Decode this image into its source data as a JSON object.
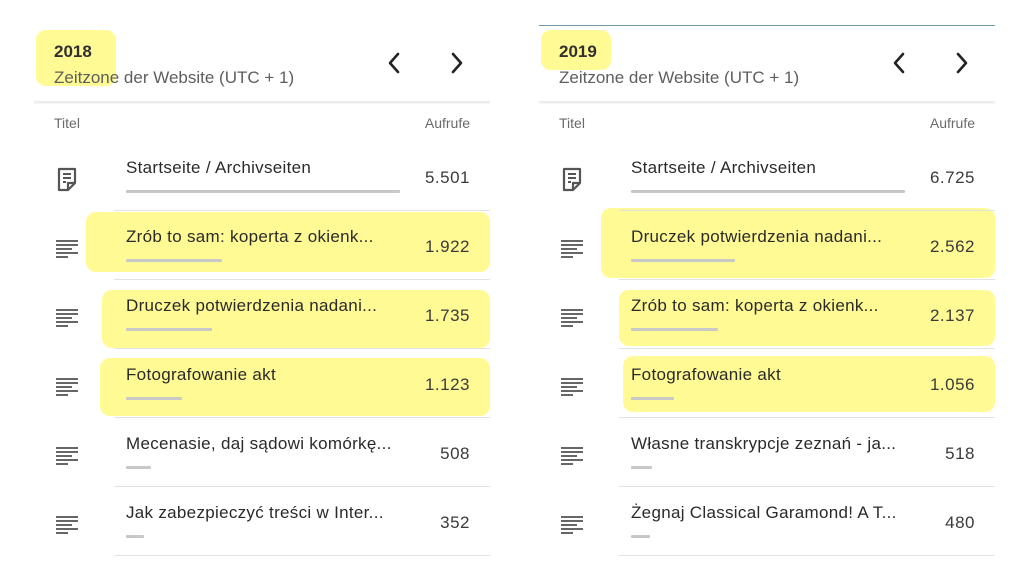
{
  "columns": {
    "title": "Titel",
    "views": "Aufrufe"
  },
  "timezone": "Zeitzone der Website (UTC + 1)",
  "panels": [
    {
      "year": "2018",
      "rows": [
        {
          "icon": "page-icon",
          "title": "Startseite / Archivseiten",
          "views": "5.501",
          "share": 1.0
        },
        {
          "icon": "post-icon",
          "title": "Zrób to sam: koperta z okienk...",
          "views": "1.922",
          "share": 0.35
        },
        {
          "icon": "post-icon",
          "title": "Druczek potwierdzenia nadani...",
          "views": "1.735",
          "share": 0.315
        },
        {
          "icon": "post-icon",
          "title": "Fotografowanie akt",
          "views": "1.123",
          "share": 0.204
        },
        {
          "icon": "post-icon",
          "title": "Mecenasie, daj sądowi komórkę...",
          "views": "508",
          "share": 0.092
        },
        {
          "icon": "post-icon",
          "title": "Jak zabezpieczyć treści w Inter...",
          "views": "352",
          "share": 0.064
        }
      ]
    },
    {
      "year": "2019",
      "rows": [
        {
          "icon": "page-icon",
          "title": "Startseite / Archivseiten",
          "views": "6.725",
          "share": 1.0
        },
        {
          "icon": "post-icon",
          "title": "Druczek potwierdzenia nadani...",
          "views": "2.562",
          "share": 0.381
        },
        {
          "icon": "post-icon",
          "title": "Zrób to sam: koperta z okienk...",
          "views": "2.137",
          "share": 0.318
        },
        {
          "icon": "post-icon",
          "title": "Fotografowanie akt",
          "views": "1.056",
          "share": 0.157
        },
        {
          "icon": "post-icon",
          "title": "Własne transkrypcje zeznań - ja...",
          "views": "518",
          "share": 0.077
        },
        {
          "icon": "post-icon",
          "title": "Żegnaj Classical Garamond! A T...",
          "views": "480",
          "share": 0.071
        }
      ]
    }
  ],
  "highlight_color": "#fff53c"
}
